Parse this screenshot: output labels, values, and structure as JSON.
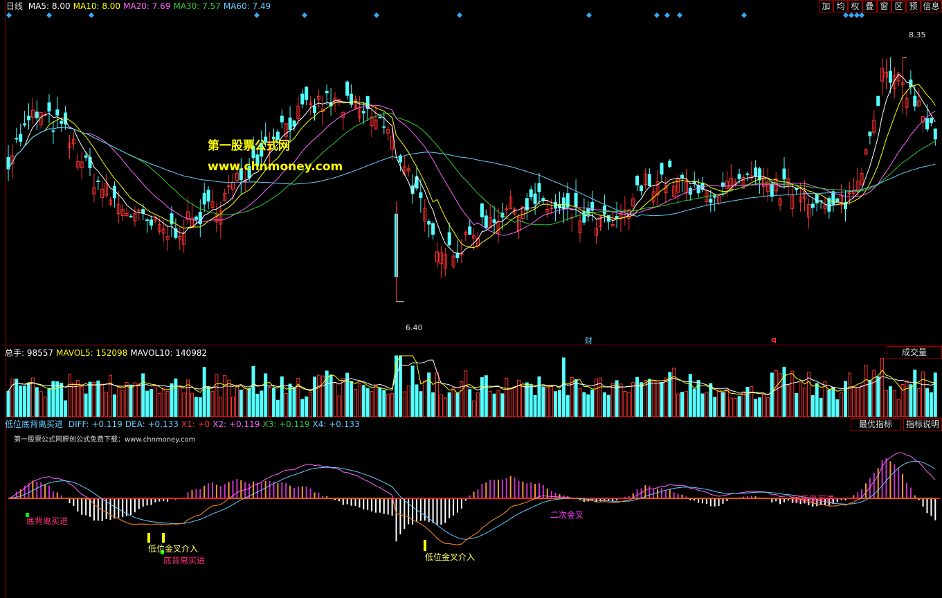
{
  "main_panel": {
    "period_label": "日线",
    "ma_legend": [
      {
        "label": "MA5: 8.00",
        "color": "#ffffff"
      },
      {
        "label": "MA10: 8.00",
        "color": "#ffff00"
      },
      {
        "label": "MA20: 7.69",
        "color": "#ff66ff"
      },
      {
        "label": "MA30: 7.57",
        "color": "#33cc33"
      },
      {
        "label": "MA60: 7.49",
        "color": "#66ccff"
      }
    ],
    "toolbar": [
      "加",
      "均",
      "权",
      "叠",
      "窗",
      "区",
      "预",
      "信息"
    ],
    "high_label": "8.35",
    "low_label": "6.40",
    "watermark_title": "第一股票公式网",
    "watermark_url": "www.chnmoney.com",
    "event_markers": [
      "财",
      "q"
    ]
  },
  "volume_panel": {
    "legend": [
      {
        "label": "总手: 98557",
        "color": "#ffffff"
      },
      {
        "label": "MAVOL5: 152098",
        "color": "#ffff00"
      },
      {
        "label": "MAVOL10: 140982",
        "color": "#ffffff"
      }
    ],
    "button": "成交量"
  },
  "indicator_panel": {
    "name": "低位底背离买进",
    "legend": [
      {
        "label": "DIFF: +0.119",
        "color": "#66ccff"
      },
      {
        "label": "DEA: +0.133",
        "color": "#66ccff"
      },
      {
        "label": "X1: +0",
        "color": "#ff3333"
      },
      {
        "label": "X2: +0.119",
        "color": "#ff66ff"
      },
      {
        "label": "X3: +0.119",
        "color": "#33cc33"
      },
      {
        "label": "X4: +0.133",
        "color": "#66ccff"
      }
    ],
    "subtitle": "第一股票公式网原创公式免费下载：www.chnmoney.com",
    "buttons": [
      "最优指标",
      "指标说明"
    ],
    "signals": [
      "底背离买进",
      "低位金叉介入",
      "底背离买进",
      "低位金叉介入",
      "二次金叉",
      "底背离买进"
    ]
  },
  "chart_data": [
    {
      "type": "candlestick",
      "title": "",
      "series": [
        {
          "name": "K线"
        },
        {
          "name": "MA5"
        },
        {
          "name": "MA10"
        },
        {
          "name": "MA20"
        },
        {
          "name": "MA30"
        },
        {
          "name": "MA60"
        }
      ],
      "ylim": [
        6.1,
        8.7
      ],
      "key_points": [
        {
          "label": "high",
          "value": 8.35
        },
        {
          "label": "low",
          "value": 6.4
        }
      ],
      "close_outline": [
        7.55,
        7.9,
        7.8,
        7.45,
        7.2,
        7.05,
        6.95,
        7.05,
        7.2,
        7.45,
        7.75,
        7.9,
        8.0,
        7.95,
        7.85,
        7.5,
        6.9,
        6.8,
        7.05,
        7.15,
        7.2,
        7.1,
        7.05,
        7.0,
        7.35,
        7.4,
        7.25,
        7.3,
        7.35,
        7.3,
        7.3,
        7.1,
        7.3,
        8.2,
        8.1,
        7.7
      ]
    },
    {
      "type": "bar",
      "title": "",
      "series": [
        {
          "name": "总手"
        },
        {
          "name": "MAVOL5"
        },
        {
          "name": "MAVOL10"
        }
      ],
      "last_values": {
        "总手": 98557,
        "MAVOL5": 152098,
        "MAVOL10": 140982
      }
    },
    {
      "type": "line",
      "title": "",
      "series": [
        {
          "name": "DIFF",
          "last": 0.119
        },
        {
          "name": "DEA",
          "last": 0.133
        },
        {
          "name": "X1",
          "last": 0
        },
        {
          "name": "X2",
          "last": 0.119
        },
        {
          "name": "X3",
          "last": 0.119
        },
        {
          "name": "X4",
          "last": 0.133
        }
      ]
    }
  ],
  "colors": {
    "up": "#ff3232",
    "down": "#54ffff",
    "grid": "#a00000",
    "bg": "#000000"
  }
}
